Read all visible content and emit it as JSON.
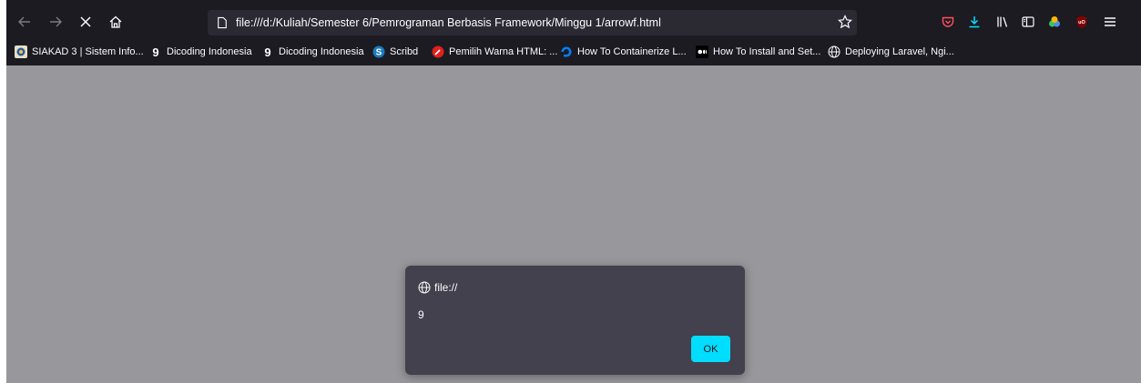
{
  "toolbar": {
    "url": "file:///d:/Kuliah/Semester 6/Pemrograman Berbasis Framework/Minggu 1/arrowf.html"
  },
  "bookmarks": [
    {
      "label": "SIAKAD 3 | Sistem Info...",
      "icon": "siakad-icon"
    },
    {
      "label": "Dicoding Indonesia",
      "icon": "dicoding-icon"
    },
    {
      "label": "Dicoding Indonesia",
      "icon": "dicoding-icon"
    },
    {
      "label": "Scribd",
      "icon": "scribd-icon"
    },
    {
      "label": "Pemilih Warna HTML: ...",
      "icon": "color-picker-icon"
    },
    {
      "label": "How To Containerize L...",
      "icon": "digitalocean-icon"
    },
    {
      "label": "How To Install and Set...",
      "icon": "medium-icon"
    },
    {
      "label": "Deploying Laravel, Ngi...",
      "icon": "globe-icon"
    }
  ],
  "dialog": {
    "origin": "file://",
    "message": "9",
    "ok_label": "OK"
  },
  "colors": {
    "chrome": "#1c1b22",
    "urlbar": "#2b2a33",
    "content": "#98979b",
    "dialog": "#42414d",
    "accent": "#00ddff",
    "pocket": "#ff4f5e",
    "ublock": "#800000"
  }
}
